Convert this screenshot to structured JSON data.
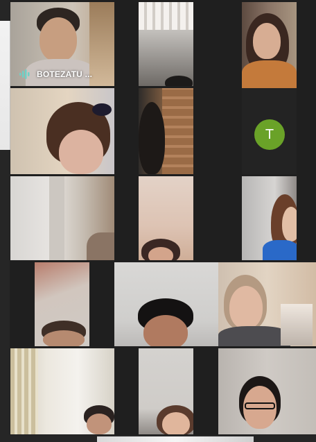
{
  "meeting": {
    "participants": [
      {
        "id": "p1",
        "name": "BOTEZATU ...",
        "speaking": true
      },
      {
        "id": "p2"
      },
      {
        "id": "p3"
      },
      {
        "id": "p4"
      },
      {
        "id": "p5"
      },
      {
        "id": "p6",
        "avatar_initial": "T",
        "avatar_color": "#6aa228"
      },
      {
        "id": "p7"
      },
      {
        "id": "p8"
      },
      {
        "id": "p9"
      },
      {
        "id": "p10"
      },
      {
        "id": "p11"
      },
      {
        "id": "p12"
      },
      {
        "id": "p13"
      },
      {
        "id": "p14"
      },
      {
        "id": "p15"
      }
    ]
  },
  "icons": {
    "mic": "mic-active-icon"
  },
  "colors": {
    "background": "#1f1f1f",
    "active_speaker_border": "#6fd1c7",
    "name_text": "#ffffff"
  }
}
